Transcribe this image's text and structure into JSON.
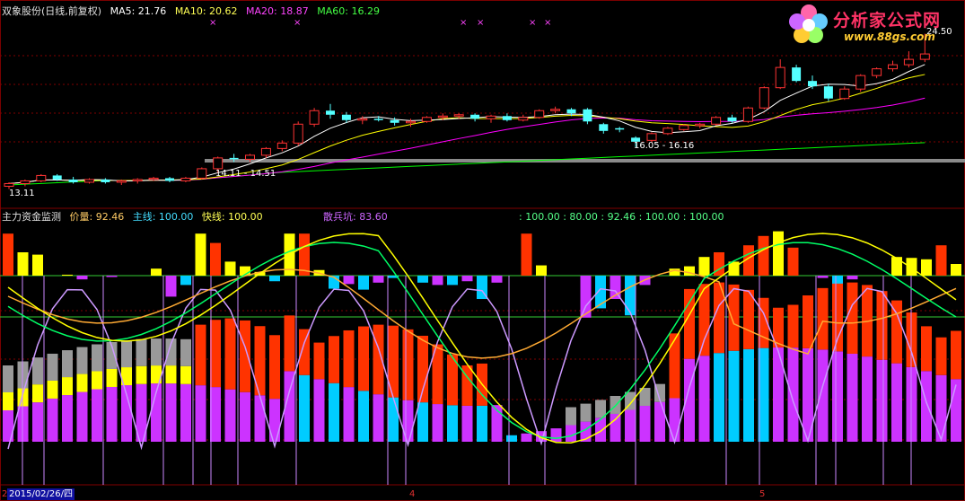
{
  "top_header": {
    "stock": "双象股份(日线,前复权)",
    "ma5": "MA5: 21.76",
    "ma10": "MA10: 20.62",
    "ma20": "MA20: 18.87",
    "ma60": "MA60: 16.29"
  },
  "indicator_header": {
    "name": "主力资金监测",
    "price": "价量: 92.46",
    "main_line": "主线: 100.00",
    "fast_line": "快线: 100.00",
    "retail": "散兵坑: 83.60",
    "values": ": 100.00 : 80.00 : 92.46 : 100.00 : 100.00"
  },
  "logo": {
    "brand": "分析家公式网",
    "url": "www.88gs.com"
  },
  "axis": {
    "date_label": "2015/02/26/四",
    "first_tick": "2",
    "ticks": [
      "4",
      "5"
    ]
  },
  "price_annotations": {
    "right_top": "24.50",
    "low_left": "14.11 - 14.51",
    "low_mid": "16.05 - 16.16",
    "first_low": "13.11"
  },
  "colors": {
    "up": "#ff3333",
    "down": "#54ffff",
    "ma5": "#ffffff",
    "ma10": "#ffff00",
    "ma20": "#ff00ff",
    "ma60": "#00ff00",
    "bar_red": "#ff3300",
    "bar_yellow": "#ffff00",
    "bar_cyan": "#00ccff",
    "bar_purple": "#cc33ff",
    "bar_gray": "#999999",
    "fast_line": "#ffff00",
    "main_line": "#00ff66",
    "price_line": "#ffaa33",
    "retail_line": "#cc99ff"
  },
  "chart_data": [
    {
      "type": "candlestick",
      "title": "双象股份(日线,前复权)",
      "candles": [
        {
          "o": 13.2,
          "h": 13.5,
          "l": 13.0,
          "c": 13.4
        },
        {
          "o": 13.4,
          "h": 13.7,
          "l": 13.2,
          "c": 13.6
        },
        {
          "o": 13.6,
          "h": 14.1,
          "l": 13.5,
          "c": 14.0
        },
        {
          "o": 14.0,
          "h": 14.1,
          "l": 13.6,
          "c": 13.7
        },
        {
          "o": 13.7,
          "h": 13.9,
          "l": 13.4,
          "c": 13.5
        },
        {
          "o": 13.5,
          "h": 13.8,
          "l": 13.4,
          "c": 13.7
        },
        {
          "o": 13.7,
          "h": 13.8,
          "l": 13.4,
          "c": 13.5
        },
        {
          "o": 13.5,
          "h": 13.7,
          "l": 13.3,
          "c": 13.6
        },
        {
          "o": 13.6,
          "h": 13.8,
          "l": 13.4,
          "c": 13.7
        },
        {
          "o": 13.7,
          "h": 13.9,
          "l": 13.6,
          "c": 13.8
        },
        {
          "o": 13.8,
          "h": 13.9,
          "l": 13.5,
          "c": 13.6
        },
        {
          "o": 13.6,
          "h": 13.9,
          "l": 13.5,
          "c": 13.8
        },
        {
          "o": 13.8,
          "h": 14.6,
          "l": 13.7,
          "c": 14.5
        },
        {
          "o": 14.5,
          "h": 15.4,
          "l": 14.2,
          "c": 15.3
        },
        {
          "o": 15.3,
          "h": 15.6,
          "l": 15.0,
          "c": 15.2
        },
        {
          "o": 15.2,
          "h": 15.6,
          "l": 15.0,
          "c": 15.5
        },
        {
          "o": 15.5,
          "h": 16.1,
          "l": 15.3,
          "c": 16.0
        },
        {
          "o": 16.0,
          "h": 16.6,
          "l": 15.8,
          "c": 16.4
        },
        {
          "o": 16.4,
          "h": 18.0,
          "l": 16.2,
          "c": 17.8
        },
        {
          "o": 17.8,
          "h": 19.0,
          "l": 17.6,
          "c": 18.8
        },
        {
          "o": 18.8,
          "h": 19.3,
          "l": 18.2,
          "c": 18.5
        },
        {
          "o": 18.5,
          "h": 18.7,
          "l": 17.9,
          "c": 18.1
        },
        {
          "o": 18.1,
          "h": 18.4,
          "l": 17.8,
          "c": 18.2
        },
        {
          "o": 18.2,
          "h": 18.4,
          "l": 18.0,
          "c": 18.1
        },
        {
          "o": 18.1,
          "h": 18.3,
          "l": 17.7,
          "c": 17.9
        },
        {
          "o": 17.9,
          "h": 18.2,
          "l": 17.6,
          "c": 18.0
        },
        {
          "o": 18.0,
          "h": 18.4,
          "l": 17.9,
          "c": 18.3
        },
        {
          "o": 18.3,
          "h": 18.6,
          "l": 18.1,
          "c": 18.4
        },
        {
          "o": 18.4,
          "h": 18.6,
          "l": 18.2,
          "c": 18.5
        },
        {
          "o": 18.5,
          "h": 18.6,
          "l": 18.0,
          "c": 18.2
        },
        {
          "o": 18.2,
          "h": 18.5,
          "l": 17.9,
          "c": 18.4
        },
        {
          "o": 18.4,
          "h": 18.6,
          "l": 18.0,
          "c": 18.1
        },
        {
          "o": 18.1,
          "h": 18.5,
          "l": 18.0,
          "c": 18.3
        },
        {
          "o": 18.3,
          "h": 18.9,
          "l": 18.2,
          "c": 18.8
        },
        {
          "o": 18.8,
          "h": 19.1,
          "l": 18.6,
          "c": 18.9
        },
        {
          "o": 18.9,
          "h": 19.0,
          "l": 18.4,
          "c": 18.6
        },
        {
          "o": 18.9,
          "h": 19.0,
          "l": 17.8,
          "c": 18.0
        },
        {
          "o": 17.8,
          "h": 17.9,
          "l": 17.1,
          "c": 17.3
        },
        {
          "o": 17.5,
          "h": 17.6,
          "l": 17.2,
          "c": 17.4
        },
        {
          "o": 16.8,
          "h": 16.9,
          "l": 16.1,
          "c": 16.5
        },
        {
          "o": 16.6,
          "h": 17.2,
          "l": 16.5,
          "c": 17.1
        },
        {
          "o": 17.1,
          "h": 17.6,
          "l": 17.0,
          "c": 17.5
        },
        {
          "o": 17.4,
          "h": 17.8,
          "l": 17.3,
          "c": 17.7
        },
        {
          "o": 17.7,
          "h": 17.9,
          "l": 17.5,
          "c": 17.8
        },
        {
          "o": 17.8,
          "h": 18.4,
          "l": 17.7,
          "c": 18.3
        },
        {
          "o": 18.3,
          "h": 18.5,
          "l": 17.9,
          "c": 18.0
        },
        {
          "o": 18.0,
          "h": 19.1,
          "l": 17.9,
          "c": 19.0
        },
        {
          "o": 19.0,
          "h": 20.6,
          "l": 18.9,
          "c": 20.5
        },
        {
          "o": 20.5,
          "h": 22.6,
          "l": 20.4,
          "c": 22.0
        },
        {
          "o": 22.0,
          "h": 22.2,
          "l": 20.9,
          "c": 21.0
        },
        {
          "o": 21.0,
          "h": 21.4,
          "l": 20.4,
          "c": 20.6
        },
        {
          "o": 20.6,
          "h": 20.8,
          "l": 19.5,
          "c": 19.7
        },
        {
          "o": 19.7,
          "h": 20.6,
          "l": 19.6,
          "c": 20.4
        },
        {
          "o": 20.4,
          "h": 21.5,
          "l": 20.2,
          "c": 21.4
        },
        {
          "o": 21.4,
          "h": 22.0,
          "l": 21.2,
          "c": 21.9
        },
        {
          "o": 21.9,
          "h": 22.5,
          "l": 21.7,
          "c": 22.2
        },
        {
          "o": 22.2,
          "h": 23.2,
          "l": 22.0,
          "c": 22.6
        },
        {
          "o": 22.6,
          "h": 24.5,
          "l": 22.4,
          "c": 23.0
        }
      ],
      "ma_series": [
        {
          "name": "MA5",
          "last": 21.76
        },
        {
          "name": "MA10",
          "last": 20.62
        },
        {
          "name": "MA20",
          "last": 18.87
        },
        {
          "name": "MA60",
          "last": 16.29
        }
      ]
    },
    {
      "type": "bar",
      "title": "主力资金监测",
      "upper_bars": [
        0.9,
        0.5,
        0.45,
        0,
        0.02,
        -0.08,
        0,
        -0.03,
        0,
        0,
        0.15,
        -0.45,
        -0.2,
        0.9,
        0.7,
        0.3,
        0.2,
        0.08,
        -0.12,
        0.9,
        0.9,
        0.12,
        -0.28,
        -0.18,
        -0.3,
        -0.15,
        -0.05,
        0,
        -0.15,
        -0.2,
        -0.2,
        -0.12,
        -0.5,
        -0.15,
        0,
        0.9,
        0.22,
        0,
        0,
        -0.9,
        -0.7,
        -0.5,
        -0.85,
        -0.2,
        0,
        0.15,
        0.2,
        0.4,
        0.5,
        0.3,
        0.65,
        0.85,
        0.95,
        0.6,
        0,
        -0.05,
        -0.3,
        -0.08,
        0,
        0,
        0.4,
        0.38,
        0.35,
        0.65,
        0.25
      ],
      "ranges": {
        "y": [
          0,
          100
        ]
      },
      "fast_line_last": 100.0,
      "main_line_last": 100.0,
      "price_volume_last": 92.46,
      "retail_last": 83.6
    }
  ]
}
